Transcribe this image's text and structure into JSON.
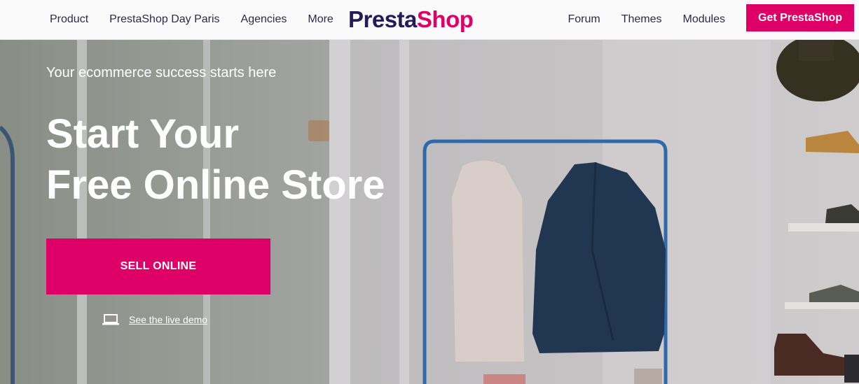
{
  "nav": {
    "left_items": [
      "Product",
      "PrestaShop Day Paris",
      "Agencies",
      "More"
    ],
    "right_items": [
      "Forum",
      "Themes",
      "Modules"
    ],
    "cta_label": "Get PrestaShop"
  },
  "logo": {
    "part1": "Presta",
    "part2": "Shop"
  },
  "hero": {
    "tagline": "Your ecommerce success starts here",
    "headline_line1": "Start Your",
    "headline_line2": "Free Online Store",
    "sell_button": "SELL ONLINE",
    "demo_link": "See the live demo"
  },
  "colors": {
    "brand_pink": "#df0067",
    "brand_navy": "#251b5b",
    "nav_text": "#2d2a4a"
  },
  "icons": {
    "demo": "laptop-icon"
  }
}
